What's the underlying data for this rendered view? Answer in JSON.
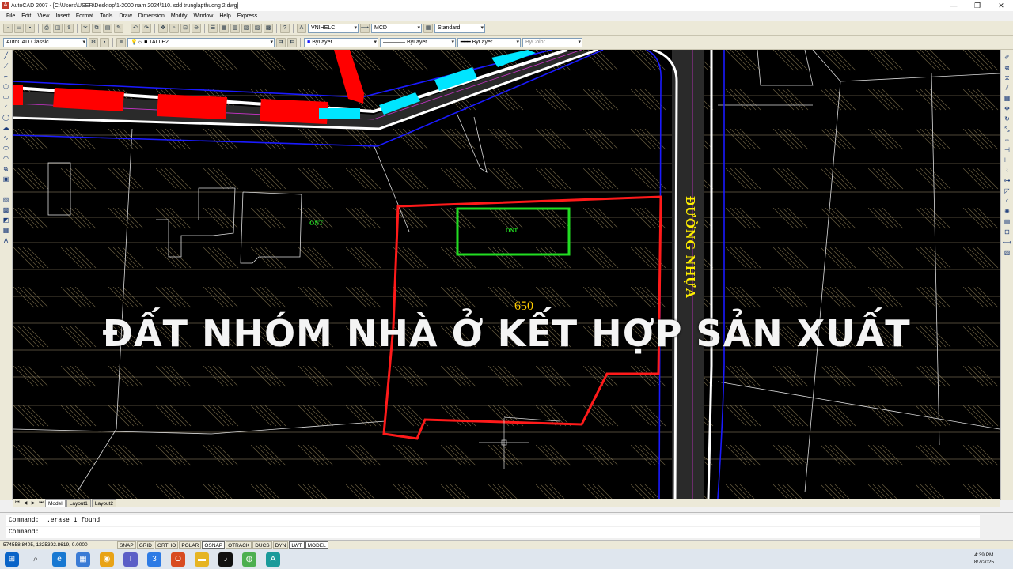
{
  "window": {
    "title": "AutoCAD 2007 - [C:\\Users\\USER\\Desktop\\1-2000 nam 2024\\110. sdd trunglapthuong 2.dwg]",
    "minimize": "—",
    "restore": "❐",
    "close": "✕"
  },
  "menu": [
    "File",
    "Edit",
    "View",
    "Insert",
    "Format",
    "Tools",
    "Draw",
    "Dimension",
    "Modify",
    "Window",
    "Help",
    "Express"
  ],
  "toolbar1": {
    "text_style": "VNIHELC",
    "dim_style": "MCD",
    "table_style": "Standard"
  },
  "toolbar2": {
    "workspace": "AutoCAD Classic",
    "layer": "TAI LE2",
    "color": "ByLayer",
    "linetype": "ByLayer",
    "lineweight": "ByLayer",
    "plotstyle": "ByColor"
  },
  "drawing": {
    "overlay_title": "ĐẤT NHÓM NHÀ Ở KẾT HỢP SẢN XUẤT",
    "label_ont_left": "ONT",
    "label_ont_box": "ONT",
    "area_value": "650",
    "road_label": "ĐƯỜNG NHỰA",
    "colors": {
      "background": "#000000",
      "parcel": "#ff1a1a",
      "house": "#22dd22",
      "road_edge": "#1a1aff",
      "road_fill": "#2a2a2a",
      "hatch_red": "#ff0000",
      "hatch_cyan": "#00e5ff",
      "road_label": "#ffee00",
      "area_label": "#ffcc00"
    }
  },
  "layout_tabs": {
    "model": "Model",
    "layout1": "Layout1",
    "layout2": "Layout2"
  },
  "command": {
    "history": "Command: _.erase 1 found",
    "prompt": "Command:"
  },
  "status": {
    "coordinates": "574558.8405, 1225392.8619, 0.0000",
    "buttons": [
      "SNAP",
      "GRID",
      "ORTHO",
      "POLAR",
      "OSNAP",
      "OTRACK",
      "DUCS",
      "DYN",
      "LWT",
      "MODEL"
    ],
    "active": [
      "OSNAP",
      "LWT",
      "MODEL"
    ]
  },
  "taskbar": {
    "time": "4:39 PM",
    "date": "8/7/2025",
    "icons": [
      "windows-icon",
      "search-icon",
      "edge-icon",
      "store-icon",
      "chrome-icon",
      "teams-icon",
      "app3-icon",
      "office-icon",
      "folder-icon",
      "tiktok-icon",
      "green-app-icon",
      "autocad-icon"
    ]
  }
}
